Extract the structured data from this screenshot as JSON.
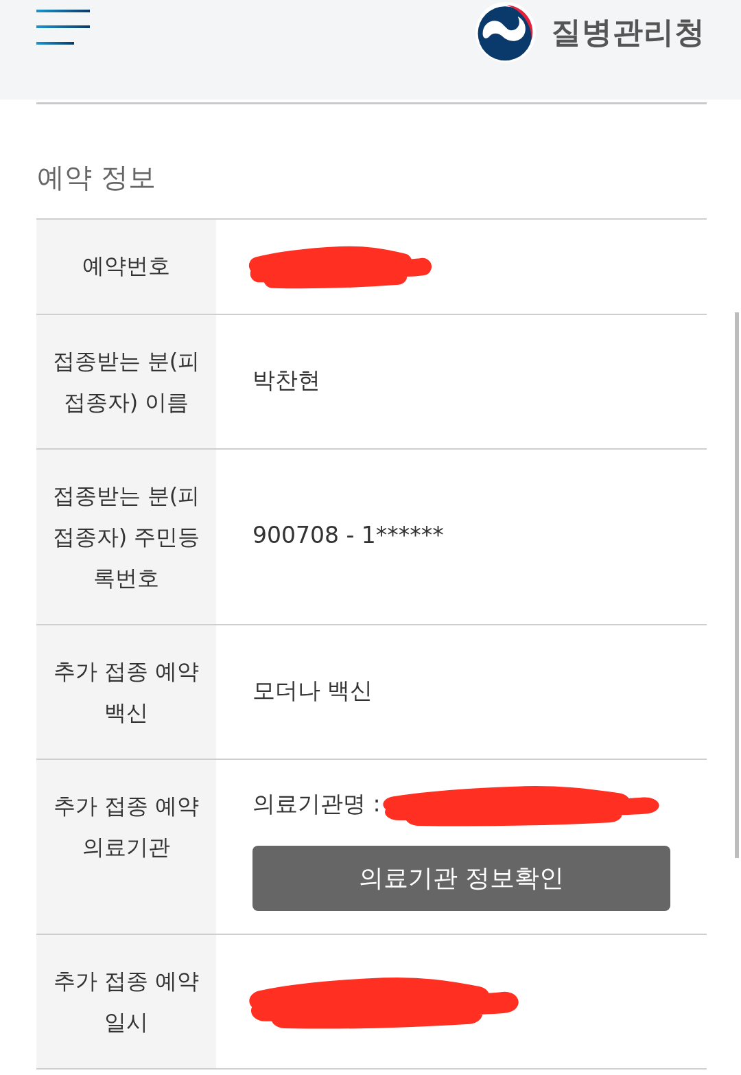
{
  "header": {
    "brand": "질병관리청"
  },
  "section": {
    "title": "예약 정보"
  },
  "rows": [
    {
      "label": "예약번호",
      "redacted": true
    },
    {
      "label": "접종받는 분(피접종자) 이름",
      "value": "박찬현",
      "redacted": false
    },
    {
      "label": "접종받는 분(피접종자) 주민등록번호",
      "value": "900708 - 1******",
      "redacted": false
    },
    {
      "label": "추가 접종 예약 백신",
      "value": "모더나 백신",
      "redacted": false
    },
    {
      "label": "추가 접종 예약 의료기관",
      "value": "의료기관명 :",
      "redacted": true,
      "button": "의료기관 정보확인"
    },
    {
      "label": "추가 접종 예약 일시",
      "redacted": true
    }
  ]
}
